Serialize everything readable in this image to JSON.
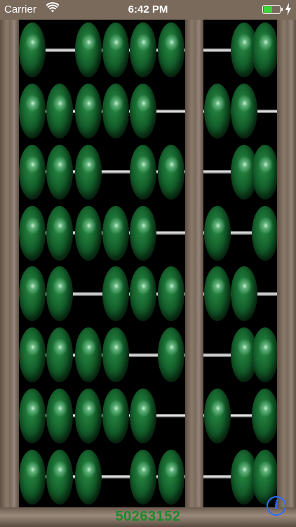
{
  "status_bar": {
    "carrier": "Carrier",
    "time": "6:42 PM",
    "wifi_icon": "wifi-icon",
    "battery_icon": "battery-icon",
    "charging_icon": "charging-bolt-icon",
    "battery_level": 0.5
  },
  "abacus": {
    "bead_color": "#14612c",
    "frame_color": "#7a6a5c",
    "rows": [
      {
        "left": [
          1,
          0,
          1,
          1,
          1,
          1
        ],
        "right": [
          0,
          1,
          1
        ]
      },
      {
        "left": [
          1,
          1,
          1,
          1,
          1,
          0
        ],
        "right": [
          1,
          1,
          0
        ]
      },
      {
        "left": [
          1,
          1,
          1,
          0,
          1,
          1
        ],
        "right": [
          0,
          1,
          1
        ]
      },
      {
        "left": [
          1,
          1,
          1,
          1,
          1,
          0
        ],
        "right": [
          1,
          0,
          1
        ]
      },
      {
        "left": [
          1,
          1,
          0,
          1,
          1,
          1
        ],
        "right": [
          1,
          1,
          0
        ]
      },
      {
        "left": [
          1,
          1,
          1,
          1,
          0,
          1
        ],
        "right": [
          0,
          1,
          1
        ]
      },
      {
        "left": [
          1,
          1,
          1,
          1,
          1,
          0
        ],
        "right": [
          1,
          0,
          1
        ]
      },
      {
        "left": [
          1,
          1,
          1,
          0,
          1,
          1
        ],
        "right": [
          0,
          1,
          1
        ]
      }
    ]
  },
  "value_display": "50263152",
  "info_button": {
    "label": "i",
    "icon": "info-icon"
  }
}
